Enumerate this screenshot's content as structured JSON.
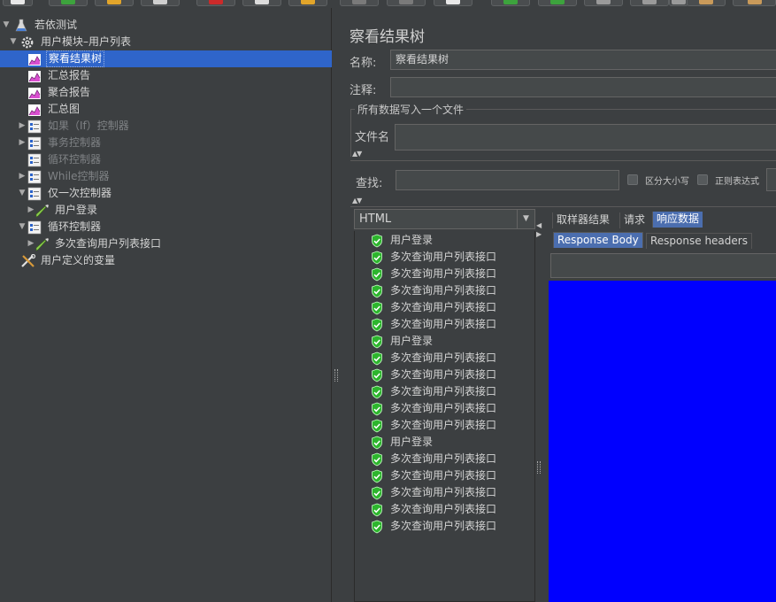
{
  "toolbar": {
    "buttons": [
      {
        "name": "new-plan-icon",
        "color": "#e8e8e8"
      },
      {
        "name": "templates-icon",
        "color": "#3da33d"
      },
      {
        "name": "open-icon",
        "color": "#e2a52a"
      },
      {
        "name": "save-icon",
        "color": "#cfcfcf"
      },
      {
        "name": "cut-icon",
        "color": "#cc2a2a"
      },
      {
        "name": "copy-icon",
        "color": "#dcdcdc"
      },
      {
        "name": "paste-icon",
        "color": "#e2a52a"
      },
      {
        "name": "expand-icon",
        "color": "#7a7a7a"
      },
      {
        "name": "collapse-icon",
        "color": "#7a7a7a"
      },
      {
        "name": "toggle-icon",
        "color": "#e8e8e8"
      },
      {
        "name": "start-icon",
        "color": "#3da33d"
      },
      {
        "name": "start-no-pause-icon",
        "color": "#3da33d"
      },
      {
        "name": "stop-icon",
        "color": "#9a9a9a"
      },
      {
        "name": "shutdown-icon",
        "color": "#9a9a9a"
      },
      {
        "name": "remote-start-icon",
        "color": "#9a9a9a"
      },
      {
        "name": "clear-icon",
        "color": "#c99a5a"
      },
      {
        "name": "clear-all-icon",
        "color": "#c99a5a"
      }
    ]
  },
  "tree": [
    {
      "label": "若依测试",
      "level": 0,
      "icon": "test-plan-icon",
      "arrow": "▼",
      "dim": false,
      "selected": false
    },
    {
      "label": "用户模块–用户列表",
      "level": 1,
      "icon": "thread-group-icon",
      "arrow": "▼",
      "dim": false,
      "selected": false
    },
    {
      "label": "察看结果树",
      "level": 2,
      "icon": "listener-chart-icon",
      "arrow": "",
      "dim": false,
      "selected": true
    },
    {
      "label": "汇总报告",
      "level": 2,
      "icon": "listener-chart-icon",
      "arrow": "",
      "dim": false,
      "selected": false
    },
    {
      "label": "聚合报告",
      "level": 2,
      "icon": "listener-chart-icon",
      "arrow": "",
      "dim": false,
      "selected": false
    },
    {
      "label": "汇总图",
      "level": 2,
      "icon": "listener-chart-icon",
      "arrow": "",
      "dim": false,
      "selected": false
    },
    {
      "label": "如果（If）控制器",
      "level": 2,
      "icon": "controller-icon",
      "arrow": "▶",
      "dim": true,
      "selected": false
    },
    {
      "label": "事务控制器",
      "level": 2,
      "icon": "controller-icon",
      "arrow": "▶",
      "dim": true,
      "selected": false
    },
    {
      "label": "循环控制器",
      "level": 2,
      "icon": "controller-icon",
      "arrow": "",
      "dim": true,
      "selected": false
    },
    {
      "label": "While控制器",
      "level": 2,
      "icon": "controller-icon",
      "arrow": "▶",
      "dim": true,
      "selected": false
    },
    {
      "label": "仅一次控制器",
      "level": 2,
      "icon": "controller-icon",
      "arrow": "▼",
      "dim": false,
      "selected": false
    },
    {
      "label": "用户登录",
      "level": 3,
      "icon": "sampler-icon",
      "arrow": "▶",
      "dim": false,
      "selected": false
    },
    {
      "label": "循环控制器",
      "level": 2,
      "icon": "controller-icon",
      "arrow": "▼",
      "dim": false,
      "selected": false
    },
    {
      "label": "多次查询用户列表接口",
      "level": 3,
      "icon": "sampler-icon",
      "arrow": "▶",
      "dim": false,
      "selected": false
    },
    {
      "label": "用户定义的变量",
      "level": 1,
      "icon": "config-tools-icon",
      "arrow": "",
      "dim": false,
      "selected": false
    }
  ],
  "panel": {
    "title": "察看结果树",
    "name_label": "名称:",
    "name_value": "察看结果树",
    "comment_label": "注释:",
    "comment_value": "",
    "file_group_title": "所有数据写入一个文件",
    "filename_label": "文件名",
    "filename_value": "",
    "search_label": "查找:",
    "search_value": "",
    "case_sensitive_label": "区分大小写",
    "regex_label": "正则表达式",
    "renderer_value": "HTML",
    "renderer_dropdown_glyph": "▼",
    "tabs": [
      "取样器结果",
      "请求",
      "响应数据"
    ],
    "active_tab": 2,
    "subtabs": [
      "Response Body",
      "Response headers"
    ],
    "active_subtab": 0,
    "response_body_color": "#0000ff"
  },
  "results": [
    {
      "label": "用户登录",
      "status": "success"
    },
    {
      "label": "多次查询用户列表接口",
      "status": "success"
    },
    {
      "label": "多次查询用户列表接口",
      "status": "success"
    },
    {
      "label": "多次查询用户列表接口",
      "status": "success"
    },
    {
      "label": "多次查询用户列表接口",
      "status": "success"
    },
    {
      "label": "多次查询用户列表接口",
      "status": "success"
    },
    {
      "label": "用户登录",
      "status": "success"
    },
    {
      "label": "多次查询用户列表接口",
      "status": "success"
    },
    {
      "label": "多次查询用户列表接口",
      "status": "success"
    },
    {
      "label": "多次查询用户列表接口",
      "status": "success"
    },
    {
      "label": "多次查询用户列表接口",
      "status": "success"
    },
    {
      "label": "多次查询用户列表接口",
      "status": "success"
    },
    {
      "label": "用户登录",
      "status": "success"
    },
    {
      "label": "多次查询用户列表接口",
      "status": "success"
    },
    {
      "label": "多次查询用户列表接口",
      "status": "success"
    },
    {
      "label": "多次查询用户列表接口",
      "status": "success"
    },
    {
      "label": "多次查询用户列表接口",
      "status": "success"
    },
    {
      "label": "多次查询用户列表接口",
      "status": "success"
    }
  ],
  "colors": {
    "background": "#3c3f41",
    "selection": "#2f65ca",
    "success": "#2db52d"
  }
}
